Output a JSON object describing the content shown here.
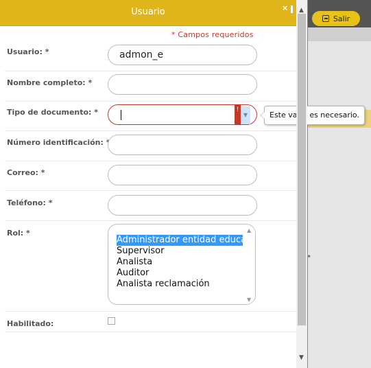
{
  "background": {
    "logout_label": "Salir",
    "star_mark": "*"
  },
  "dialog": {
    "title": "Usuario",
    "close_glyph": "×",
    "required_note": "* Campos requeridos",
    "fields": {
      "usuario": {
        "label": "Usuario: *",
        "value": "admon_e"
      },
      "nombre": {
        "label": "Nombre completo: *",
        "value": ""
      },
      "tipo_doc": {
        "label": "Tipo de documento: *",
        "value": "",
        "error_flag": "!",
        "dropdown_glyph": "▼",
        "tooltip": "Este valor es necesario."
      },
      "numero": {
        "label": "Número identificación: *",
        "value": ""
      },
      "correo": {
        "label": "Correo: *",
        "value": ""
      },
      "telefono": {
        "label": "Teléfono: *",
        "value": ""
      },
      "rol": {
        "label": "Rol: *",
        "options": [
          "Administrador entidad educa",
          "Supervisor",
          "Analista",
          "Auditor",
          "Analista reclamación"
        ],
        "selected": "Administrador entidad educa"
      },
      "habilitado": {
        "label": "Habilitado:",
        "checked": false
      }
    }
  },
  "colors": {
    "header": "#e0b51c",
    "error": "#c0392b",
    "selection": "#3399ff"
  },
  "icons": {
    "close": "close-icon",
    "scroll_up": "arrow-up-icon",
    "scroll_down": "arrow-down-icon",
    "logout": "logout-icon"
  }
}
